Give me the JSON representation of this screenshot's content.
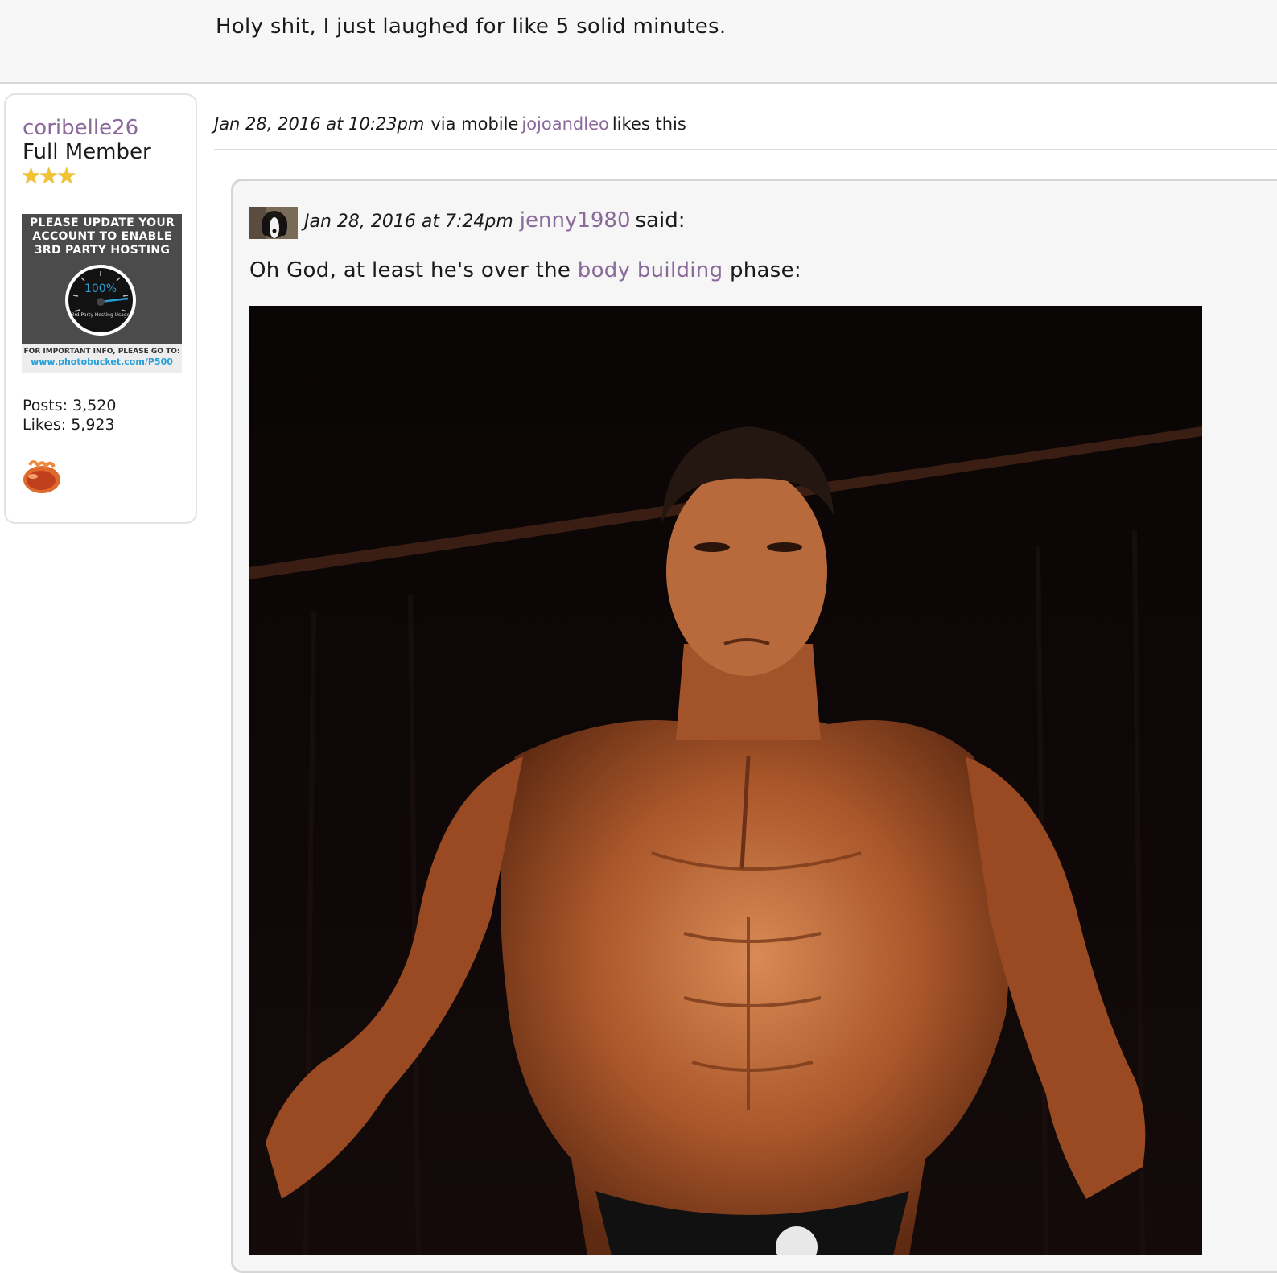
{
  "previous_post": {
    "text": "Holy shit, I just laughed for like 5 solid minutes."
  },
  "user": {
    "name": "coribelle26",
    "rank": "Full Member",
    "stars": "★★★",
    "star_count": 3,
    "stats": {
      "posts": "Posts: 3,520",
      "likes": "Likes: 5,923"
    },
    "badge_icon": "bean-badge-icon",
    "banner": {
      "heading": "PLEASE UPDATE YOUR ACCOUNT TO ENABLE 3RD PARTY HOSTING",
      "gauge_value": "100%",
      "gauge_label": "3rd Party Hosting Usage",
      "footer_line1": "FOR IMPORTANT INFO, PLEASE GO TO:",
      "footer_line2": "www.photobucket.com/P500"
    }
  },
  "post": {
    "date": "Jan 28, 2016 at 10:23pm",
    "via": "via mobile",
    "liker": "jojoandleo",
    "likes_suffix": "likes this"
  },
  "quote": {
    "date": "Jan 28, 2016 at 7:24pm",
    "author": "jenny1980",
    "said": "said:",
    "text_before": "Oh God, at least he's over the ",
    "link_text": "body building",
    "text_after": " phase:",
    "image_icon": "bodybuilder-photo"
  },
  "colors": {
    "link": "#8a6a9a",
    "quote_bg": "#f6f6f6",
    "border": "#d6d6d6",
    "star": "#f2c230"
  }
}
